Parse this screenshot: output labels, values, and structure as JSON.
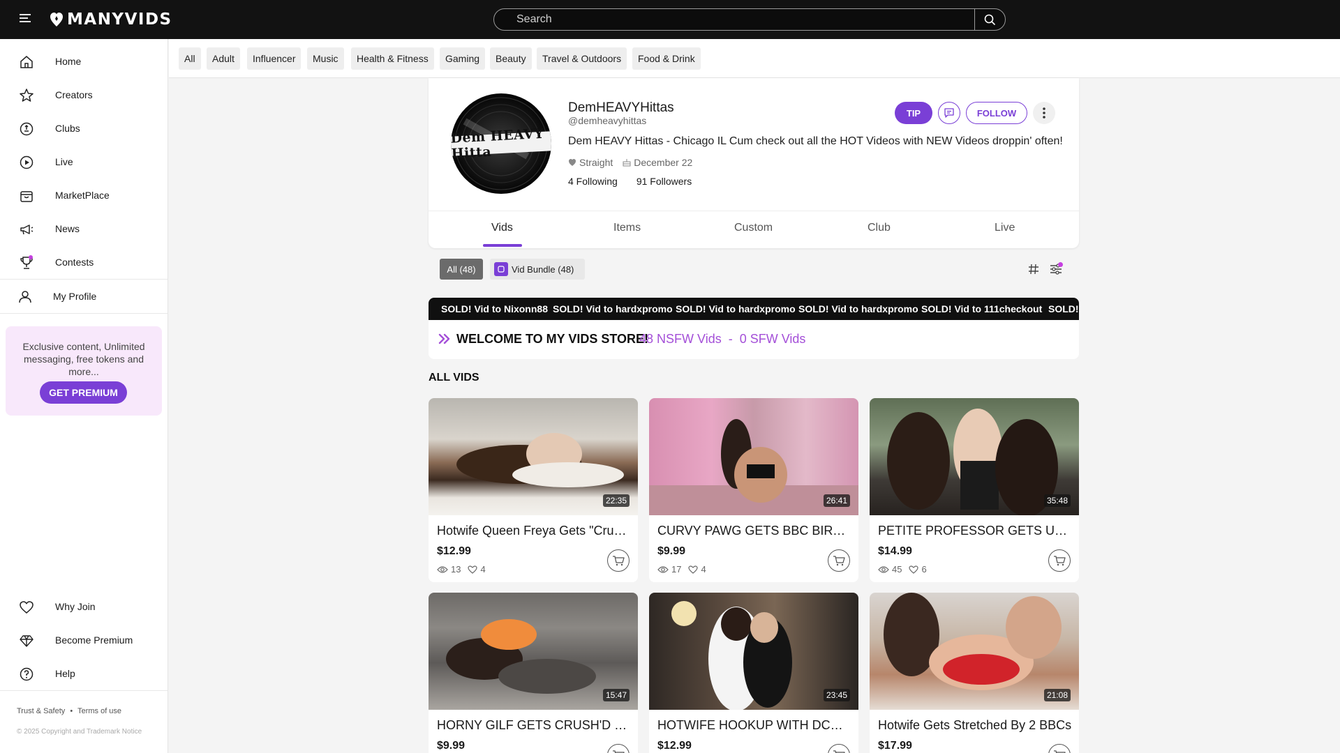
{
  "header": {
    "logo_text": "MANYVIDS",
    "search_placeholder": "Search"
  },
  "sidebar": {
    "items": [
      {
        "label": "Home",
        "icon": "home-icon"
      },
      {
        "label": "Creators",
        "icon": "star-icon"
      },
      {
        "label": "Clubs",
        "icon": "clubs-icon"
      },
      {
        "label": "Live",
        "icon": "live-icon"
      },
      {
        "label": "MarketPlace",
        "icon": "bag-icon"
      },
      {
        "label": "News",
        "icon": "megaphone-icon"
      },
      {
        "label": "Contests",
        "icon": "trophy-icon"
      }
    ],
    "profile_label": "My Profile",
    "promo_text": "Exclusive content, Unlimited messaging, free tokens and more...",
    "promo_button": "GET PREMIUM",
    "bottom_items": [
      {
        "label": "Why Join",
        "icon": "heart-icon"
      },
      {
        "label": "Become Premium",
        "icon": "diamond-icon"
      },
      {
        "label": "Help",
        "icon": "help-icon"
      }
    ],
    "footer_trust": "Trust & Safety",
    "footer_sep": "•",
    "footer_terms": "Terms of use",
    "copyright": "© 2025 Copyright and Trademark Notice"
  },
  "categories": [
    "All",
    "Adult",
    "Influencer",
    "Music",
    "Health & Fitness",
    "Gaming",
    "Beauty",
    "Travel & Outdoors",
    "Food & Drink"
  ],
  "profile": {
    "avatar_text": "Dem HEAVY Hitta",
    "name": "DemHEAVYHittas",
    "handle": "@demheavyhittas",
    "bio": "Dem HEAVY Hittas - Chicago IL Cum check out all the HOT Videos with NEW Videos droppin' often!",
    "orientation": "Straight",
    "birthday": "December 22",
    "following": "4 Following",
    "followers": "91 Followers",
    "tip_label": "TIP",
    "follow_label": "FOLLOW"
  },
  "tabs": [
    "Vids",
    "Items",
    "Custom",
    "Club",
    "Live"
  ],
  "active_tab": "Vids",
  "filters": {
    "all_label": "All (48)",
    "bundle_label": "Vid Bundle (48)"
  },
  "ticker": [
    "SOLD! Vid to Nixonn88",
    "SOLD! Vid to hardxpromo",
    "SOLD! Vid to hardxpromo",
    "SOLD! Vid to hardxpromo",
    "SOLD! Vid to 111checkout",
    "SOLD! Vid to"
  ],
  "welcome": {
    "title": "WELCOME TO MY VIDS STORE!",
    "counts": "48 NSFW Vids  -  0 SFW Vids"
  },
  "section_title": "ALL VIDS",
  "videos": [
    {
      "title": "Hotwife Queen Freya Gets \"Crush'd\" By A BBC",
      "price": "$12.99",
      "views": "13",
      "likes": "4",
      "duration": "22:35"
    },
    {
      "title": "CURVY PAWG GETS BBC BIRTHDAY GIFT",
      "price": "$9.99",
      "views": "17",
      "likes": "4",
      "duration": "26:41"
    },
    {
      "title": "PETITE PROFESSOR GETS UNFORGETTABLE",
      "price": "$14.99",
      "views": "45",
      "likes": "6",
      "duration": "35:48"
    },
    {
      "title": "HORNY GILF GETS CRUSH'D BY BBC",
      "price": "$9.99",
      "views": "",
      "likes": "",
      "duration": "15:47"
    },
    {
      "title": "HOTWIFE HOOKUP WITH DCRUSH",
      "price": "$12.99",
      "views": "",
      "likes": "",
      "duration": "23:45"
    },
    {
      "title": "Hotwife Gets Stretched By 2 BBCs",
      "price": "$17.99",
      "views": "",
      "likes": "",
      "duration": "21:08"
    }
  ],
  "colors": {
    "accent": "#7a3fd6",
    "topbar": "#121212",
    "welcome_counts": "#a44fd8"
  }
}
